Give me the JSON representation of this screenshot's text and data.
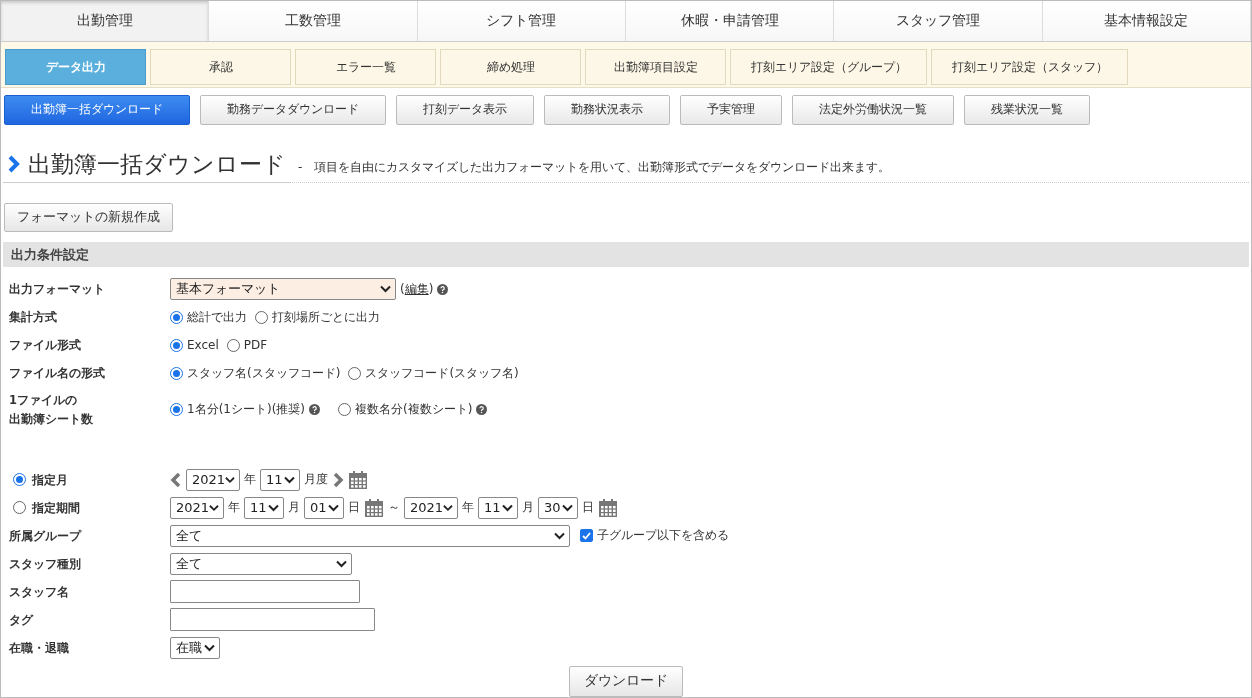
{
  "main_tabs": [
    {
      "label": "出勤管理",
      "selected": true
    },
    {
      "label": "工数管理",
      "selected": false
    },
    {
      "label": "シフト管理",
      "selected": false
    },
    {
      "label": "休暇・申請管理",
      "selected": false
    },
    {
      "label": "スタッフ管理",
      "selected": false
    },
    {
      "label": "基本情報設定",
      "selected": false
    }
  ],
  "sub_tabs": [
    {
      "label": "データ出力",
      "selected": true
    },
    {
      "label": "承認",
      "selected": false
    },
    {
      "label": "エラー一覧",
      "selected": false
    },
    {
      "label": "締め処理",
      "selected": false
    },
    {
      "label": "出勤簿項目設定",
      "selected": false
    },
    {
      "label": "打刻エリア設定",
      "note": "（グループ）",
      "selected": false
    },
    {
      "label": "打刻エリア設定",
      "note": "（スタッフ）",
      "selected": false
    }
  ],
  "action_tabs": [
    {
      "label": "出勤簿一括ダウンロード",
      "selected": true
    },
    {
      "label": "勤務データダウンロード",
      "selected": false
    },
    {
      "label": "打刻データ表示",
      "selected": false
    },
    {
      "label": "勤務状況表示",
      "selected": false
    },
    {
      "label": "予実管理",
      "selected": false
    },
    {
      "label": "法定外労働状況一覧",
      "selected": false
    },
    {
      "label": "残業状況一覧",
      "selected": false
    }
  ],
  "page": {
    "title": "出勤簿一括ダウンロード",
    "separator": "-",
    "description": "項目を自由にカスタマイズした出力フォーマットを用いて、出勤簿形式でデータをダウンロード出来ます。"
  },
  "new_format_button": "フォーマットの新規作成",
  "section_title": "出力条件設定",
  "rows": [
    {
      "kind": "select",
      "label": "出力フォーマット",
      "value": "基本フォーマット",
      "highlight": true,
      "edit": {
        "open": "(",
        "link": "編集",
        "close": ")"
      },
      "help": true
    },
    {
      "kind": "radio",
      "label": "集計方式",
      "options": [
        {
          "label": "総計で出力",
          "selected": true
        },
        {
          "label": "打刻場所ごとに出力",
          "selected": false
        }
      ]
    },
    {
      "kind": "radio",
      "label": "ファイル形式",
      "options": [
        {
          "label": "Excel",
          "selected": true
        },
        {
          "label": "PDF",
          "selected": false
        }
      ]
    },
    {
      "kind": "radio",
      "label": "ファイル名の形式",
      "options": [
        {
          "label": "スタッフ名(スタッフコード)",
          "selected": true
        },
        {
          "label": "スタッフコード(スタッフ名)",
          "selected": false
        }
      ]
    },
    {
      "kind": "radio",
      "label_lines": [
        "1ファイルの",
        "出勤簿シート数"
      ],
      "options": [
        {
          "label": "1名分(1シート)(推奨)",
          "selected": true,
          "help": true
        },
        {
          "label": "複数名分(複数シート)",
          "selected": false,
          "help": true
        }
      ]
    },
    {
      "kind": "period",
      "label": "指定月",
      "selected": true,
      "parts": [
        {
          "kind": "prev"
        },
        {
          "kind": "select",
          "value": "2021"
        },
        {
          "kind": "text",
          "value": "年"
        },
        {
          "kind": "select",
          "value": "11"
        },
        {
          "kind": "text",
          "value": "月度"
        },
        {
          "kind": "next"
        },
        {
          "kind": "calendar"
        }
      ]
    },
    {
      "kind": "period",
      "label": "指定期間",
      "selected": false,
      "parts": [
        {
          "kind": "select",
          "value": "2021"
        },
        {
          "kind": "text",
          "value": "年"
        },
        {
          "kind": "select",
          "value": "11"
        },
        {
          "kind": "text",
          "value": "月"
        },
        {
          "kind": "select",
          "value": "01"
        },
        {
          "kind": "text",
          "value": "日"
        },
        {
          "kind": "calendar"
        },
        {
          "kind": "text",
          "value": "～"
        },
        {
          "kind": "select",
          "value": "2021"
        },
        {
          "kind": "text",
          "value": "年"
        },
        {
          "kind": "select",
          "value": "11"
        },
        {
          "kind": "text",
          "value": "月"
        },
        {
          "kind": "select",
          "value": "30"
        },
        {
          "kind": "text",
          "value": "日"
        },
        {
          "kind": "calendar"
        }
      ]
    },
    {
      "kind": "select",
      "label": "所属グループ",
      "value": "全て",
      "checkbox": {
        "label": "子グループ以下を含める",
        "checked": true
      }
    },
    {
      "kind": "select",
      "label": "スタッフ種別",
      "value": "全て"
    },
    {
      "kind": "input",
      "label": "スタッフ名"
    },
    {
      "kind": "input",
      "label": "タグ"
    },
    {
      "kind": "select",
      "label": "在職・退職",
      "value": "在職"
    }
  ],
  "download_button": "ダウンロード"
}
